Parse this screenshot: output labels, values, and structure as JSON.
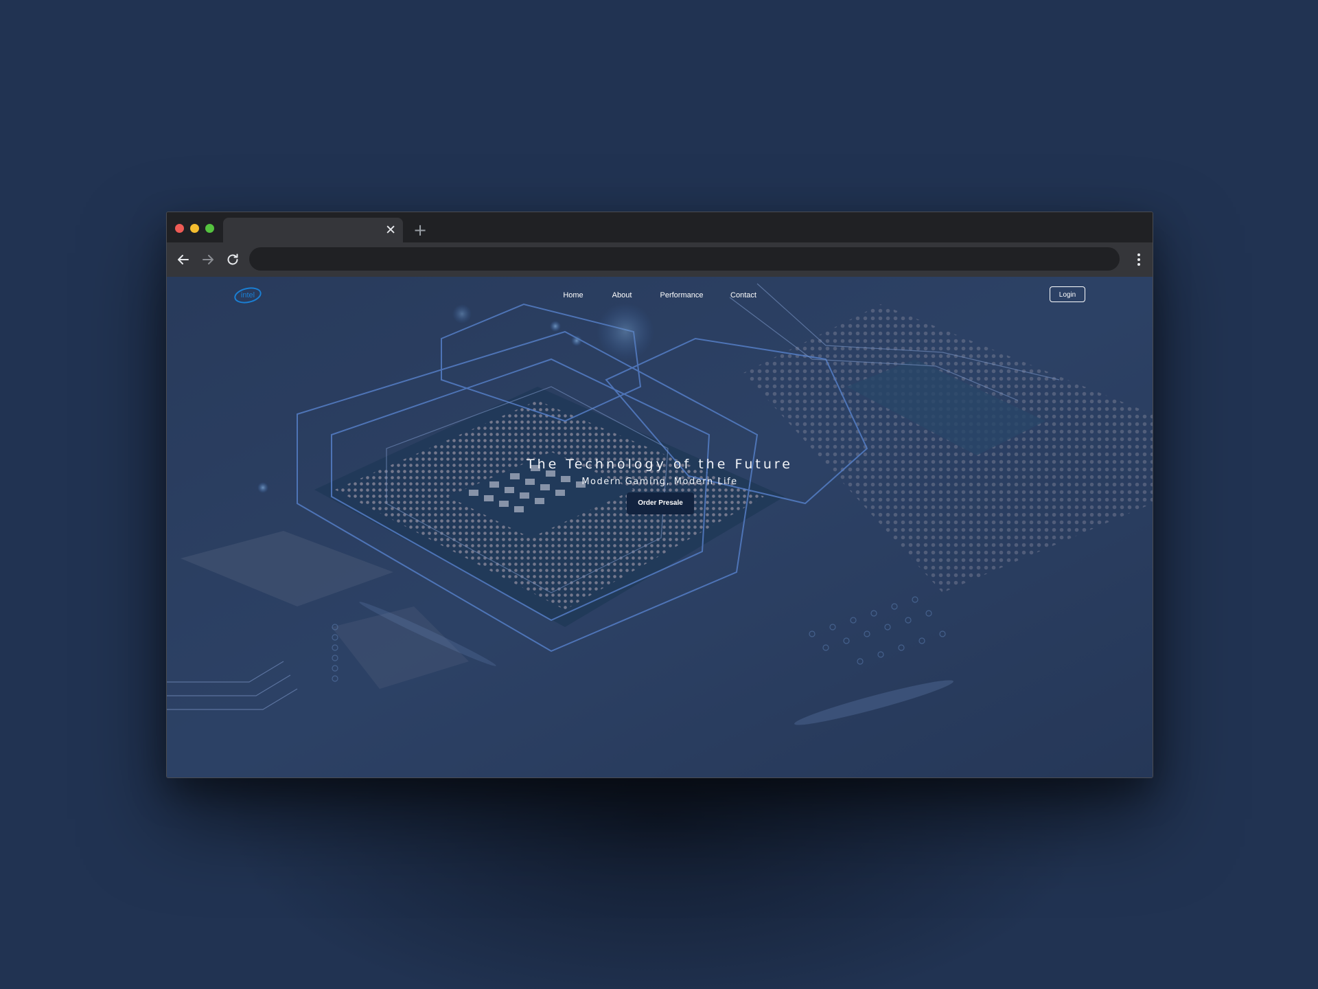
{
  "browser": {
    "tab": {
      "close_icon": "close-icon"
    },
    "new_tab_icon": "plus-icon",
    "toolbar": {
      "back_icon": "arrow-left-icon",
      "forward_icon": "arrow-right-icon",
      "reload_icon": "reload-icon",
      "address_value": "",
      "menu_icon": "more-vertical-icon"
    }
  },
  "site": {
    "logo_text": "intel",
    "nav": [
      "Home",
      "About",
      "Performance",
      "Contact"
    ],
    "login_label": "Login",
    "hero": {
      "title": "The Technology of the Future",
      "subtitle": "Modern Gaming, Modern Life",
      "cta_label": "Order Presale"
    }
  },
  "colors": {
    "page_background": "#213352",
    "browser_chrome": "#202124",
    "toolbar": "#35363a",
    "cta_background": "#12233f",
    "logo": "#1a7fd4",
    "traffic_red": "#ee5b55",
    "traffic_yellow": "#f4bd2f",
    "traffic_green": "#55c33f"
  }
}
